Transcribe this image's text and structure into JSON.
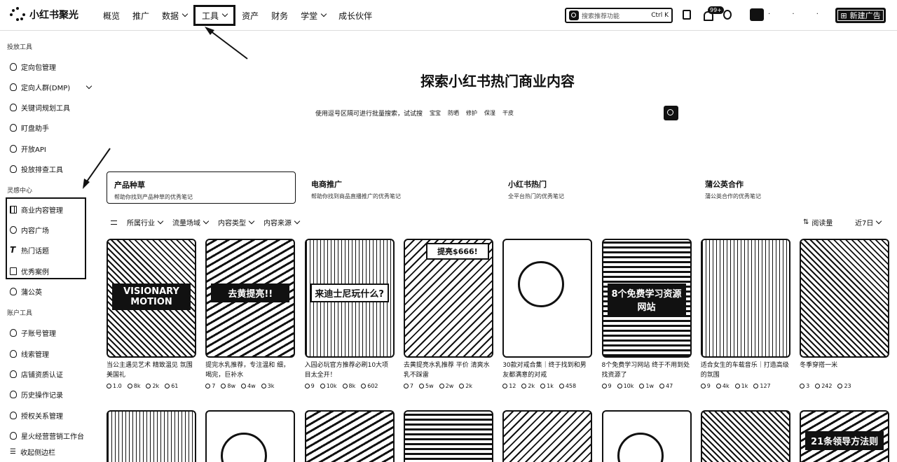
{
  "app": {
    "logo_text": "小红书聚光"
  },
  "nav": {
    "items": [
      {
        "label": "概览",
        "dropdown": false
      },
      {
        "label": "推广",
        "dropdown": false
      },
      {
        "label": "数据",
        "dropdown": true
      },
      {
        "label": "工具",
        "dropdown": true,
        "active": true
      },
      {
        "label": "资产",
        "dropdown": false
      },
      {
        "label": "财务",
        "dropdown": false
      },
      {
        "label": "学堂",
        "dropdown": true
      },
      {
        "label": "成长伙伴",
        "dropdown": false
      }
    ]
  },
  "header": {
    "search_placeholder": "搜索推荐功能",
    "search_shortcut": "Ctrl K",
    "notification_badge": "99+",
    "create_button": "新建广告"
  },
  "sidebar": {
    "groups": [
      {
        "label": "投放工具"
      },
      {
        "label": "灵感中心"
      },
      {
        "label": "账户工具"
      }
    ],
    "items": [
      {
        "label": "定向包管理"
      },
      {
        "label": "定向人群(DMP)"
      },
      {
        "label": "关键词规划工具"
      },
      {
        "label": "盯盘助手"
      },
      {
        "label": "开放API"
      },
      {
        "label": "投放排查工具"
      },
      {
        "label": "商业内容管理"
      },
      {
        "label": "内容广场"
      },
      {
        "label": "热门话题"
      },
      {
        "label": "优秀案例"
      },
      {
        "label": "蒲公英"
      },
      {
        "label": "子账号管理"
      },
      {
        "label": "线索管理"
      },
      {
        "label": "店铺资质认证"
      },
      {
        "label": "历史操作记录"
      },
      {
        "label": "授权关系管理"
      },
      {
        "label": "星火经营营销工作台"
      }
    ],
    "collapse_label": "收起侧边栏"
  },
  "main": {
    "hero_title": "探索小红书热门商业内容",
    "hint_text": "使用逗号区隔可进行批量搜索，试试搜",
    "hint_keywords": [
      "宝宝",
      "防晒",
      "修护",
      "保湿",
      "干皮"
    ],
    "categories": [
      {
        "title": "产品种草",
        "sub": "帮助你找到产品种草的优秀笔记",
        "active": true
      },
      {
        "title": "电商推广",
        "sub": "帮助你找到商品直播推广的优秀笔记",
        "active": false
      },
      {
        "title": "小红书热门",
        "sub": "全平台热门的优秀笔记",
        "active": false
      },
      {
        "title": "蒲公英合作",
        "sub": "蒲公英合作的优秀笔记",
        "active": false
      }
    ],
    "filters": [
      {
        "label": "所属行业"
      },
      {
        "label": "流量场域"
      },
      {
        "label": "内容类型"
      },
      {
        "label": "内容来源"
      }
    ],
    "sort_label": "阅读量",
    "range_label": "近7日",
    "cards": [
      {
        "title": "当公主遇见艺术 精致温见 氛围 美国礼",
        "thumb_text": "VISIONARY MOTION",
        "stats": [
          "1.0",
          "8k",
          "2k",
          "61"
        ]
      },
      {
        "title": "提完水乳推荐，专注温和 细，喝完，巨补水",
        "thumb_text": "去黄提亮!!",
        "stats": [
          "7",
          "8w",
          "4w",
          "3k"
        ]
      },
      {
        "title": "入园必玩官方推荐必刷10大项目太全开！",
        "thumb_text": "来迪士尼玩什么?",
        "stats": [
          "9",
          "10k",
          "8k",
          "602"
        ]
      },
      {
        "title": "去黄提亮水乳推荐 平价 清爽水乳不踩雷",
        "thumb_text": "提亮$666!",
        "stats": [
          "7",
          "5w",
          "2w",
          "2k"
        ]
      },
      {
        "title": "30款对戒合集｜终于找到和男友都满意的对戒",
        "thumb_text": "",
        "stats": [
          "12",
          "2k",
          "1k",
          "458"
        ]
      },
      {
        "title": "8个免费学习网站 终于不用到处找资源了",
        "thumb_text": "8个免费学习资源网站",
        "stats": [
          "9",
          "10k",
          "1w",
          "47"
        ]
      },
      {
        "title": "适合女生的车载音乐｜打造高级的氛围",
        "thumb_text": "",
        "stats": [
          "9",
          "4k",
          "1k",
          "127"
        ]
      },
      {
        "title": "冬季穿搭一米",
        "thumb_text": "",
        "stats": [
          "3",
          "242",
          "23",
          ""
        ]
      }
    ],
    "row2_cards": [
      {
        "thumb_text": ""
      },
      {
        "thumb_text": ""
      },
      {
        "thumb_text": ""
      },
      {
        "thumb_text": ""
      },
      {
        "thumb_text": ""
      },
      {
        "thumb_text": ""
      },
      {
        "thumb_text": ""
      },
      {
        "thumb_text": "21条领导方法则"
      }
    ]
  }
}
